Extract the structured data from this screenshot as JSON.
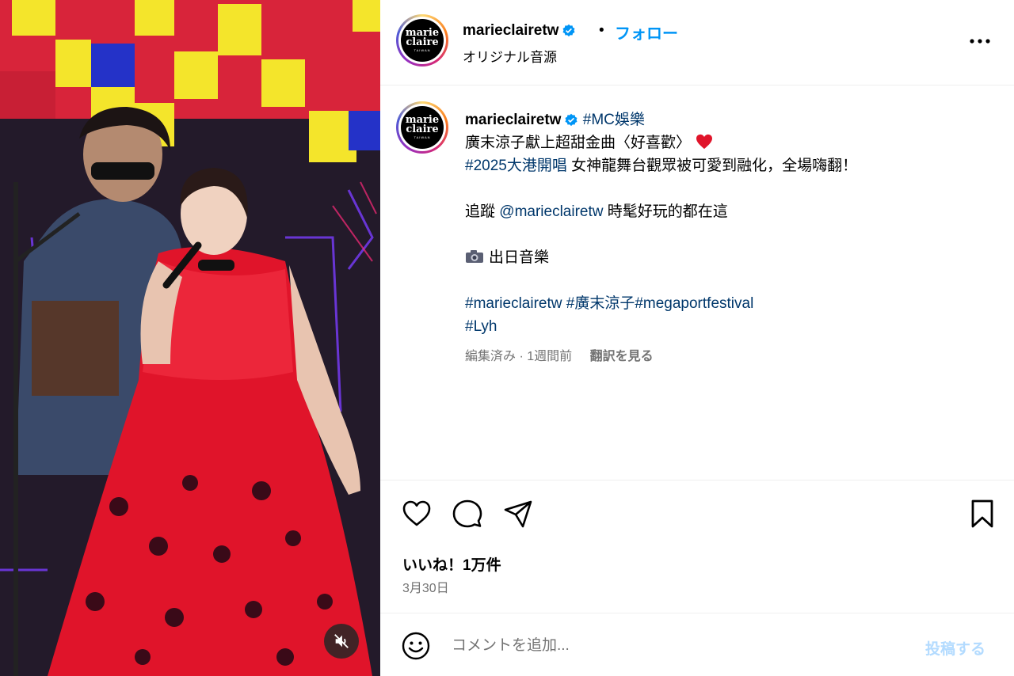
{
  "header": {
    "username": "marieclairetw",
    "dot": "•",
    "follow_label": "フォロー",
    "audio": "オリジナル音源",
    "more_icon": "more-horizontal-icon"
  },
  "avatar": {
    "line1": "marie",
    "line2": "claire",
    "line3": "TAIWAN"
  },
  "caption": {
    "username": "marieclairetw",
    "first_tag": "#MC娛樂",
    "line1": "廣末涼子獻上超甜金曲〈好喜歡〉",
    "line2_tag": "#2025大港開唱",
    "line2_text": " 女神龍舞台觀眾被可愛到融化，全場嗨翻！",
    "line3_text": "追蹤 ",
    "line3_mention": "@marieclairetw",
    "line3_rest": " 時髦好玩的都在這",
    "line4_text": "出日音樂",
    "tags_line1": "#marieclairetw #廣末涼子#megaportfestival",
    "tags_line2": "#Lyh"
  },
  "meta": {
    "edited_time": "編集済み · 1週間前",
    "translate": "翻訳を見る"
  },
  "actions": {
    "like_icon": "heart-icon",
    "comment_icon": "comment-icon",
    "share_icon": "share-icon",
    "save_icon": "bookmark-icon",
    "likes": "いいね！1万件",
    "date": "3月30日"
  },
  "comment": {
    "placeholder": "コメントを追加...",
    "post_label": "投稿する"
  },
  "colors": {
    "accent": "#0095f6",
    "tag": "#00376b",
    "muted": "#737373",
    "post_disabled": "#b3dbff",
    "dress": "#e0142a"
  }
}
